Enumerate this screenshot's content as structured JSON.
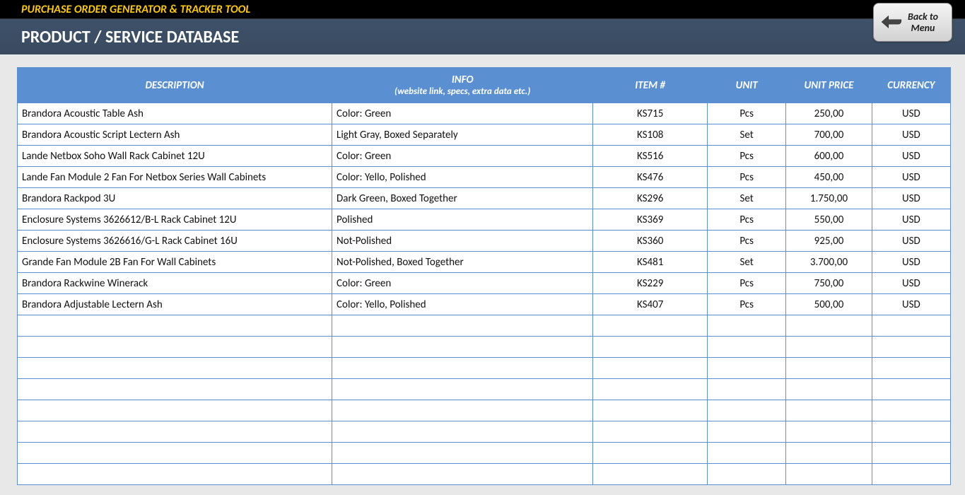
{
  "app_title": "PURCHASE ORDER GENERATOR & TRACKER TOOL",
  "page_title": "PRODUCT / SERVICE DATABASE",
  "back_button": {
    "line1": "Back to",
    "line2": "Menu"
  },
  "columns": {
    "description": "DESCRIPTION",
    "info_main": "INFO",
    "info_sub": "(website link, specs, extra data etc.)",
    "item": "ITEM #",
    "unit": "UNIT",
    "price": "UNIT PRICE",
    "currency": "CURRENCY"
  },
  "rows": [
    {
      "description": "Brandora Acoustic Table Ash",
      "info": "Color: Green",
      "item": "KS715",
      "unit": "Pcs",
      "price": "250,00",
      "currency": "USD"
    },
    {
      "description": "Brandora Acoustic Script Lectern Ash",
      "info": "Light Gray, Boxed Separately",
      "item": "KS108",
      "unit": "Set",
      "price": "700,00",
      "currency": "USD"
    },
    {
      "description": "Lande Netbox Soho Wall Rack Cabinet 12U",
      "info": "Color: Green",
      "item": "KS516",
      "unit": "Pcs",
      "price": "600,00",
      "currency": "USD"
    },
    {
      "description": "Lande Fan Module 2 Fan For Netbox Series Wall Cabinets",
      "info": "Color: Yello, Polished",
      "item": "KS476",
      "unit": "Pcs",
      "price": "450,00",
      "currency": "USD"
    },
    {
      "description": "Brandora Rackpod 3U",
      "info": "Dark Green, Boxed Together",
      "item": "KS296",
      "unit": "Set",
      "price": "1.750,00",
      "currency": "USD"
    },
    {
      "description": "Enclosure Systems 3626612/B-L Rack Cabinet 12U",
      "info": "Polished",
      "item": "KS369",
      "unit": "Pcs",
      "price": "550,00",
      "currency": "USD"
    },
    {
      "description": "Enclosure Systems 3626616/G-L Rack Cabinet 16U",
      "info": "Not-Polished",
      "item": "KS360",
      "unit": "Pcs",
      "price": "925,00",
      "currency": "USD"
    },
    {
      "description": "Grande Fan Module 2B Fan For Wall Cabinets",
      "info": "Not-Polished, Boxed Together",
      "item": "KS481",
      "unit": "Set",
      "price": "3.700,00",
      "currency": "USD"
    },
    {
      "description": "Brandora Rackwine Winerack",
      "info": "Color: Green",
      "item": "KS229",
      "unit": "Pcs",
      "price": "750,00",
      "currency": "USD"
    },
    {
      "description": "Brandora Adjustable Lectern Ash",
      "info": "Color: Yello, Polished",
      "item": "KS407",
      "unit": "Pcs",
      "price": "500,00",
      "currency": "USD"
    }
  ],
  "empty_rows": 8
}
